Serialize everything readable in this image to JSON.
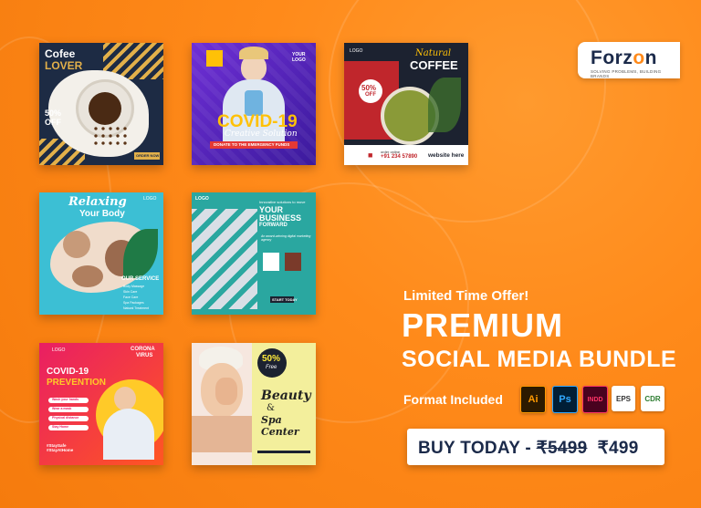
{
  "brand": {
    "logo_text_a": "Forz",
    "logo_text_o": "o",
    "logo_text_b": "n",
    "tagline": "SOLVING PROBLEMS, BUILDING BRANDS"
  },
  "tiles": {
    "coffee_lover": {
      "title1": "Cofee",
      "title2": "LOVER",
      "discount": "50%",
      "discount_sub": "OFF",
      "cta": "ORDER NOW"
    },
    "covid_solution": {
      "logo": "YOUR LOGO",
      "title": "COVID-19",
      "script": "Creative Solution",
      "banner": "DONATE TO THE EMERGENCY FUNDS"
    },
    "natural_coffee": {
      "logo": "LOGO",
      "script": "Natural",
      "title": "COFFEE",
      "discount": "50%",
      "discount_sub": "OFF",
      "order_label": "order online",
      "phone": "+91 234 57890",
      "website": "website here"
    },
    "relaxing": {
      "title1": "Relaxing",
      "title2": "Your Body",
      "logo": "LOGO",
      "section": "OUR SERVICE",
      "services": [
        "Body Massage",
        "Skin Care",
        "Face Care",
        "Spa Packages",
        "Natural Treatment"
      ]
    },
    "business": {
      "logo": "LOGO",
      "kicker": "Innovative solutions to move",
      "title1": "YOUR",
      "title2": "BUSINESS",
      "title3": "FORWARD",
      "sub": "An award-winning digital marketing agency",
      "cta": "START TODAY"
    },
    "covid_prevention": {
      "logo": "LOGO",
      "corner1": "CORONA",
      "corner2": "VIRUS",
      "title1": "COVID-19",
      "title2": "PREVENTION",
      "items": [
        "Wash your hands",
        "Wear a mask",
        "Physical distance",
        "Stay Home"
      ],
      "hashtags": "#StaySafe #StayAtHome"
    },
    "beauty_spa": {
      "discount": "50%",
      "discount_sub": "Free",
      "title1": "Beauty",
      "title2": "&",
      "title3": "Spa Center"
    }
  },
  "promo": {
    "offer": "Limited Time Offer!",
    "title1": "PREMIUM",
    "title2": "SOCIAL MEDIA BUNDLE",
    "format_label": "Format Included",
    "formats": [
      {
        "name": "Ai",
        "label": "AI"
      },
      {
        "name": "Ps",
        "label": "PSD"
      },
      {
        "name": "INDD",
        "label": "INDD"
      },
      {
        "name": "EPS",
        "label": "EPS"
      },
      {
        "name": "CDR",
        "label": "CDR"
      }
    ],
    "buy_prefix": "BUY TODAY - ",
    "old_price": "₹5499",
    "new_price": "₹499"
  },
  "colors": {
    "background": "#ff8a1a",
    "navy": "#1b2a4a",
    "white": "#ffffff"
  }
}
